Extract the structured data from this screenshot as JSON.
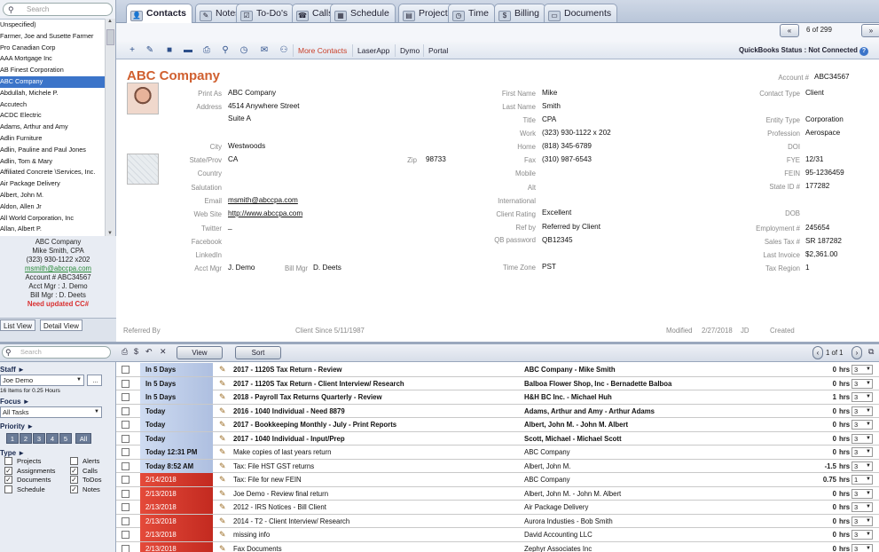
{
  "left": {
    "search_placeholder": "Search",
    "clients": [
      "Unspecified)",
      "Farmer, Joe and Susette Farmer",
      "Pro Canadian Corp",
      "AAA Mortgage Inc",
      "AB Finest Corporation",
      "ABC Company",
      "Abdullah, Michele P.",
      "Accutech",
      "ACDC Electric",
      "Adams, Arthur and Amy",
      "Adlin Furniture",
      "Adlin, Pauline and Paul Jones",
      "Adlin, Tom & Mary",
      "Affiliated Concrete \\Services, Inc.",
      "Air Package Delivery",
      "Albert, John M.",
      "Aldon, Allen Jr",
      "All World Corporation, Inc",
      "Allan, Albert P."
    ],
    "selected_index": 5,
    "card": {
      "company": "ABC Company",
      "contact": "Mike Smith, CPA",
      "phone": "(323) 930-1122 x202",
      "email": "msmith@abccpa.com",
      "account": "Account # ABC34567",
      "acct_mgr": "Acct Mgr : J. Demo",
      "bill_mgr": "Bill Mgr : D. Deets",
      "warning": "Need updated CC#"
    },
    "view_tabs": [
      "List View",
      "Detail View"
    ]
  },
  "tabs": [
    "Contacts",
    "Notes",
    "To-Do's",
    "Calls",
    "Schedule",
    "Projects",
    "Time",
    "Billing",
    "Documents"
  ],
  "tab_icons": [
    "contacts-icon",
    "notes-icon",
    "todo-icon",
    "calls-icon",
    "schedule-icon",
    "projects-icon",
    "time-icon",
    "billing-icon",
    "documents-icon"
  ],
  "pager": {
    "first": "«",
    "text": "6 of 299",
    "next": "»"
  },
  "toolbar": {
    "links": [
      "More Contacts",
      "LaserApp",
      "Dymo",
      "Portal"
    ],
    "qb_status": "QuickBooks Status : Not Connected"
  },
  "contact": {
    "company": "ABC Company",
    "print_as_label": "Print As",
    "print_as": "ABC Company",
    "address_label": "Address",
    "address1": "4514 Anywhere Street",
    "address2": "Suite A",
    "city_label": "City",
    "city": "Westwoods",
    "state_label": "State/Prov",
    "state": "CA",
    "zip_label": "Zip",
    "zip": "98733",
    "country_label": "Country",
    "salutation_label": "Salutation",
    "email_label": "Email",
    "email": "msmith@abccpa.com",
    "web_label": "Web Site",
    "web": "http://www.abccpa.com",
    "twitter_label": "Twitter",
    "twitter": "_",
    "facebook_label": "Facebook",
    "linkedin_label": "LinkedIn",
    "acct_mgr_label": "Acct Mgr",
    "acct_mgr": "J. Demo",
    "bill_mgr_label": "Bill Mgr",
    "bill_mgr": "D. Deets",
    "first_label": "First Name",
    "first": "Mike",
    "last_label": "Last Name",
    "last": "Smith",
    "title_label": "Title",
    "title": "CPA",
    "work_label": "Work",
    "work": "(323) 930-1122  x 202",
    "home_label": "Home",
    "home": "(818) 345-6789",
    "fax_label": "Fax",
    "fax": "(310) 987-6543",
    "mobile_label": "Mobile",
    "alt_label": "Alt",
    "intl_label": "International",
    "rating_label": "Client Rating",
    "rating": "Excellent",
    "ref_label": "Ref by",
    "ref": "Referred by Client",
    "qb_label": "QB password",
    "qb": "QB12345",
    "tz_label": "Time Zone",
    "tz": "PST",
    "acct_label": "Account #",
    "acct": "ABC34567",
    "ctype_label": "Contact Type",
    "ctype": "Client",
    "entity_label": "Entity Type",
    "entity": "Corporation",
    "prof_label": "Profession",
    "prof": "Aerospace",
    "doi_label": "DOI",
    "fye_label": "FYE",
    "fye": "12/31",
    "fein_label": "FEIN",
    "fein": "95-1236459",
    "stateid_label": "State ID #",
    "stateid": "177282",
    "dob_label": "DOB",
    "emp_label": "Employment #",
    "emp": "245654",
    "sales_label": "Sales Tax #",
    "sales": "SR 187282",
    "lastinv_label": "Last Invoice",
    "lastinv": "$2,361.00",
    "taxreg_label": "Tax Region",
    "taxreg": "1",
    "referred_by_label": "Referred By",
    "client_since": "Client Since 5/11/1987",
    "modified_label": "Modified",
    "modified": "2/27/2018",
    "modified_by": "JD",
    "created_label": "Created"
  },
  "task_toolbar": {
    "search_placeholder": "Search",
    "view": "View",
    "sort": "Sort",
    "page": "1 of 1"
  },
  "filters": {
    "staff": "Staff ►",
    "staff_value": "Joe Demo",
    "staff_btn": "...",
    "count": "16 Items for 0.25 Hours",
    "focus": "Focus ►",
    "focus_value": "All Tasks",
    "priority": "Priority ►",
    "priority_buttons": [
      "1",
      "2",
      "3",
      "4",
      "5",
      "All"
    ],
    "type": "Type ►",
    "types": [
      {
        "label": "Projects",
        "checked": false
      },
      {
        "label": "Assignments",
        "checked": true
      },
      {
        "label": "Documents",
        "checked": true
      },
      {
        "label": "Schedule",
        "checked": false
      },
      {
        "label": "Alerts",
        "checked": false
      },
      {
        "label": "Calls",
        "checked": true
      },
      {
        "label": "ToDos",
        "checked": true
      },
      {
        "label": "Notes",
        "checked": true
      }
    ]
  },
  "tasks": [
    {
      "due": "In 5 Days",
      "style": "blue",
      "desc": "2017 - 1120S Tax Return - Review",
      "bold": true,
      "who": "ABC Company - Mike Smith",
      "hrs": "0",
      "pr": "3"
    },
    {
      "due": "In 5 Days",
      "style": "blue",
      "desc": "2017 - 1120S Tax Return - Client Interview/ Research",
      "bold": true,
      "who": "Balboa Flower Shop, Inc - Bernadette Balboa",
      "hrs": "0",
      "pr": "3"
    },
    {
      "due": "In 5 Days",
      "style": "blue",
      "desc": "2018 - Payroll Tax Returns Quarterly - Review",
      "bold": true,
      "who": "H&H BC Inc. - Michael Huh",
      "hrs": "1",
      "pr": "3"
    },
    {
      "due": "Today",
      "style": "blue",
      "desc": "2016 - 1040 Individual - Need 8879",
      "bold": true,
      "who": "Adams, Arthur and Amy - Arthur Adams",
      "hrs": "0",
      "pr": "3"
    },
    {
      "due": "Today",
      "style": "blue",
      "desc": "2017 - Bookkeeping Monthly - July - Print Reports",
      "bold": true,
      "who": "Albert, John M. - John M. Albert",
      "hrs": "0",
      "pr": "3"
    },
    {
      "due": "Today",
      "style": "blue",
      "desc": "2017 - 1040 Individual - Input/Prep",
      "bold": true,
      "who": "Scott, Michael - Michael Scott",
      "hrs": "0",
      "pr": "3"
    },
    {
      "due": "Today 12:31 PM",
      "style": "blue",
      "desc": "Make copies of last years return",
      "bold": false,
      "who": "ABC Company",
      "hrs": "0",
      "pr": "3"
    },
    {
      "due": "Today 8:52 AM",
      "style": "blue",
      "desc": "Tax: File HST GST returns",
      "bold": false,
      "who": "Albert, John M.",
      "hrs": "-1.5",
      "pr": "3"
    },
    {
      "due": "2/14/2018",
      "style": "red",
      "desc": "Tax: File for new FEIN",
      "bold": false,
      "who": "ABC Company",
      "hrs": "0.75",
      "pr": "1"
    },
    {
      "due": "2/13/2018",
      "style": "red",
      "desc": "Joe Demo - Review final return",
      "bold": false,
      "who": "Albert, John M. - John M. Albert",
      "hrs": "0",
      "pr": "3"
    },
    {
      "due": "2/13/2018",
      "style": "red",
      "desc": "2012 - IRS Notices - Bill Client",
      "bold": false,
      "who": "Air Package Delivery",
      "hrs": "0",
      "pr": "3"
    },
    {
      "due": "2/13/2018",
      "style": "red",
      "desc": "2014 - T2 - Client Interview/ Research",
      "bold": false,
      "who": "Aurora Industies - Bob Smith",
      "hrs": "0",
      "pr": "3"
    },
    {
      "due": "2/13/2018",
      "style": "red",
      "desc": "missing info",
      "bold": false,
      "who": "David Accounting LLC",
      "hrs": "0",
      "pr": "3"
    },
    {
      "due": "2/13/2018",
      "style": "red",
      "desc": "Fax Documents",
      "bold": false,
      "who": "Zephyr Associates Inc",
      "hrs": "0",
      "pr": "3"
    }
  ],
  "hrs_unit": "hrs",
  "colors": {
    "accent": "#3b74c9",
    "company": "#d06030",
    "overdue": "#c32a20"
  }
}
